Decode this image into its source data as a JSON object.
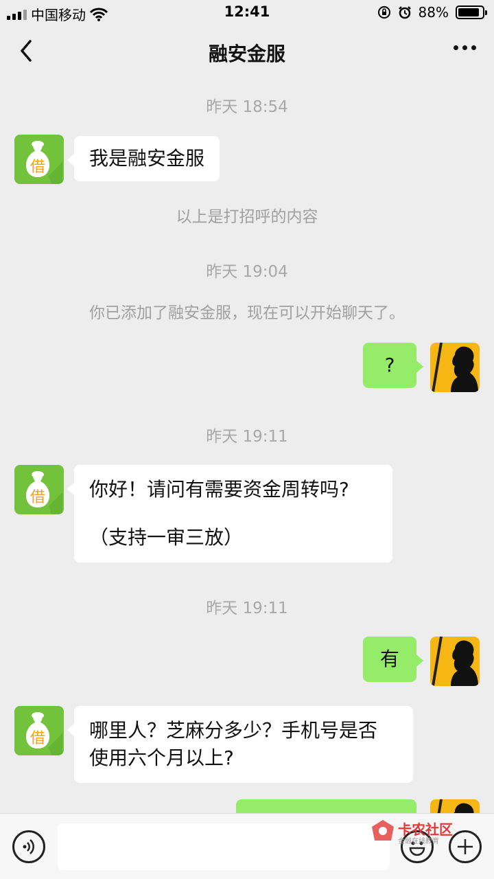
{
  "status_bar": {
    "carrier": "中国移动",
    "time": "12:41",
    "battery": "88%"
  },
  "nav": {
    "title": "融安金服"
  },
  "avatars": {
    "bot_char": "借"
  },
  "messages": {
    "t1": "昨天 18:54",
    "m1": "我是融安金服",
    "s1": "以上是打招呼的内容",
    "t2": "昨天 19:04",
    "s2": "你已添加了融安金服，现在可以开始聊天了。",
    "m2": "?",
    "t3": "昨天 19:11",
    "m3_line1": "你好！请问有需要资金周转吗?",
    "m3_line2": "（支持一审三放）",
    "t4": "昨天 19:11",
    "m4": "有",
    "m5_line1": "哪里人？芝麻分多少？手机号是否",
    "m5_line2": "使用六个月以上?"
  },
  "watermark": {
    "title": "卡农社区",
    "sub": "金融在线教育"
  },
  "colors": {
    "background": "#ededed",
    "bubble_self": "#95ec69",
    "bubble_other": "#ffffff",
    "bot_avatar": "#72c23c",
    "user_avatar": "#f6b715"
  },
  "icons": [
    "signal-icon",
    "wifi-icon",
    "orientation-lock-icon",
    "alarm-icon",
    "battery-icon",
    "back-icon",
    "more-icon",
    "voice-icon",
    "emoji-icon",
    "plus-icon"
  ]
}
